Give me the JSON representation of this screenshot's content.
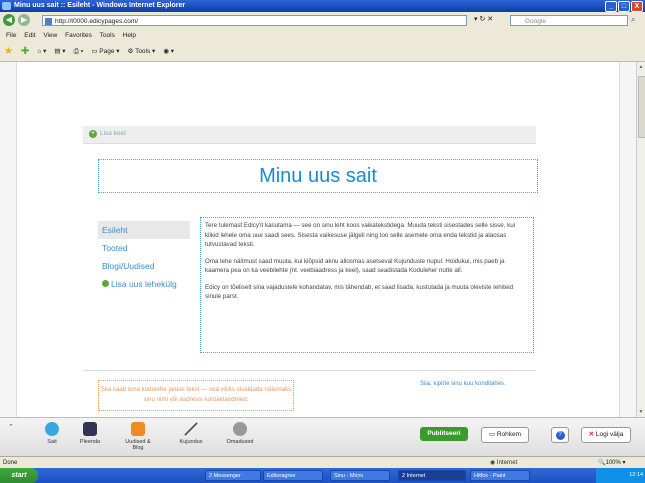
{
  "window": {
    "title": "Minu uus sait :: Esileht - Windows Internet Explorer",
    "controls": [
      "_",
      "□",
      "X"
    ]
  },
  "browser": {
    "address": "http://t0000.edicypages.com/",
    "search_placeholder": "Google",
    "menu": [
      "File",
      "Edit",
      "View",
      "Favorites",
      "Tools",
      "Help"
    ],
    "toolbar": {
      "page_label": "Page",
      "tools_label": "Tools"
    }
  },
  "site": {
    "edit_header_label": "Lisa keel",
    "title": "Minu uus sait",
    "nav": [
      "Esileht",
      "Tooted",
      "Blogi/Uudised"
    ],
    "nav_add": "Lisa uus lehekülg",
    "content": [
      "Tere tulemast Edicy'it kasutama — see on sinu leht koos vaikatekstidega. Muuda teksti sisestades selle sisse, kui klikid lehele oma uue saadi sees. Sisesta vaikesuse jälgeli ning too selle asemele oma enda tekstid ja alaosas tutvustavad teksti.",
      "Oma lehe näitmust saad muuta, kui klõpsid aknu allosmas asetseval Kujunduste nupul. Hoidukui, mis paeb ja kaamera pea on ka veebilehte (nt. veebiaadress ja keel), saad seadistada Koduleher nutte all.",
      "Edicy on tõeliselt sina vajadustele kohandatav, mis tähendab, et saad lisada, kustutada ja muuta oleviste Iehiteid sinule parst."
    ],
    "footer_text": "Siia saab oma kodulehe jaluse tekst — sea võiks sisaldada nätemaks sinu nimi või aadressi kontaktandmed.",
    "footer_link": "Siia, kiprite sinu kuu konditahes."
  },
  "editor": {
    "buttons": [
      "Sait",
      "Pleenda",
      "Uudised & Blog",
      "Kujundus",
      "Omadused"
    ],
    "publish": "Publitseeri",
    "more": "Rohkem",
    "help": "?",
    "logout": "Logi välja"
  },
  "status": {
    "left": "Done",
    "zone": "Internet",
    "zoom": "100%"
  },
  "taskbar": {
    "start": "start",
    "tasks": [
      "2 Messenger",
      "Editoragree",
      "Sinu - Micro",
      "2 Internet",
      "Hitfox - Paint"
    ],
    "clock": "12:14"
  }
}
